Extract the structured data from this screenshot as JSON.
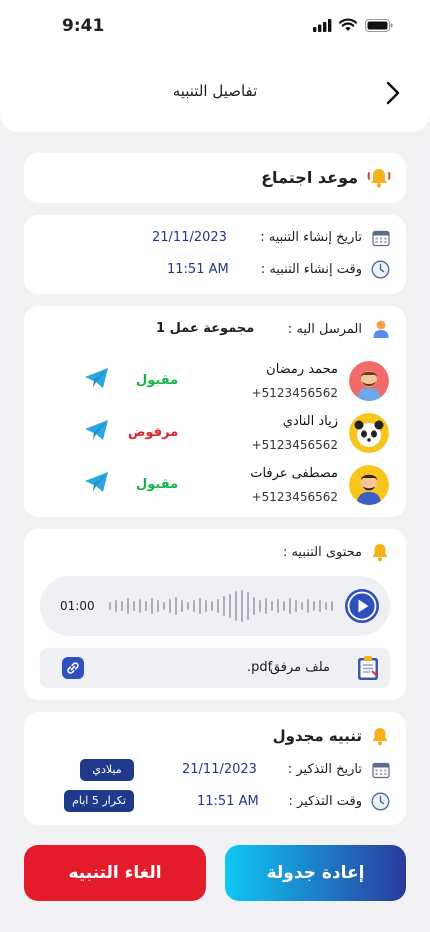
{
  "status_bar": {
    "time": "9:41"
  },
  "header": {
    "title": "تفاصيل التنبيه"
  },
  "event": {
    "title": "موعد اجتماع"
  },
  "info": {
    "created_date_label": "تاريخ إنشاء التنبيه :",
    "created_date": "21/11/2023",
    "created_time_label": "وقت إنشاء التنبيه :",
    "created_time": "11:51 AM"
  },
  "recipients": {
    "label": "المرسل اليه :",
    "group": "مجموعة عمل 1",
    "people": [
      {
        "name": "محمد رمضان",
        "phone": "+5123456562",
        "status": "مقبول"
      },
      {
        "name": "زياد النادي",
        "phone": "+5123456562",
        "status": "مرفوض"
      },
      {
        "name": "مصطفى عرفات",
        "phone": "+5123456562",
        "status": "مقبول"
      }
    ]
  },
  "content": {
    "label": "محتوى التنبيه :",
    "audio_time": "01:00",
    "attachment_label": "ملف مرفق",
    "attachment_name": ".pdf"
  },
  "schedule": {
    "title": "تنبيه مجدول",
    "reminder_date_label": "تاريخ التذكير :",
    "reminder_date": "21/11/2023",
    "date_tag": "ميلادي",
    "reminder_time_label": "وقت التذكير :",
    "reminder_time": "11:51 AM",
    "repeat_tag": "تكرار 5 ايام"
  },
  "actions": {
    "reschedule": "إعادة جدولة",
    "cancel": "الغاء التنبيه"
  },
  "colors": {
    "accent_blue": "#1f3a8a",
    "accepted": "#18b34a",
    "rejected": "#e0212d",
    "cancel_button": "#e31b2b",
    "reschedule_gradient_start": "#0ec8f5",
    "reschedule_gradient_end": "#2a3a9c"
  }
}
